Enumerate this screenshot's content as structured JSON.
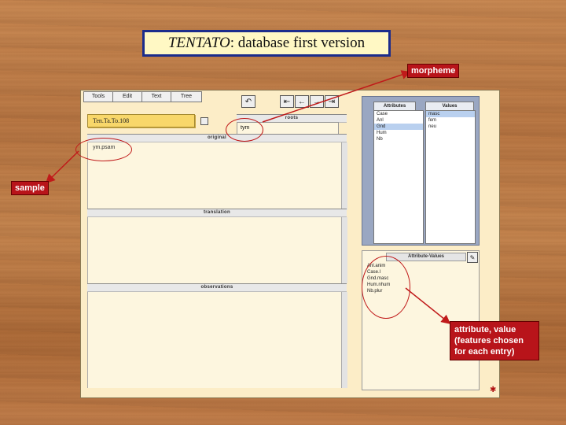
{
  "slide": {
    "title_italic": "TENTATO",
    "title_rest": ": database first version"
  },
  "callouts": {
    "morpheme": "morpheme",
    "sample": "sample",
    "attr_note_lines": [
      "attribute, value",
      "(features chosen",
      "for each entry)"
    ]
  },
  "app": {
    "menu": [
      "Tools",
      "Edit",
      "Text",
      "Tree"
    ],
    "nav_icons": [
      "back-to-start-icon",
      "back-icon",
      "forward-icon",
      "forward-to-end-icon"
    ],
    "entry_name": "Ten.Ta.To.108",
    "sections": {
      "original": "original",
      "translation": "translation",
      "observations": "observations",
      "roots": "roots"
    },
    "original_text": "ym.psam",
    "morpheme_value": "tym",
    "attributes": {
      "header": "Attributes",
      "items": [
        "Case",
        "Anl",
        "Gnd",
        "Hum",
        "Nb"
      ],
      "selected": "Gnd"
    },
    "values": {
      "header": "Values",
      "items": [
        "masc",
        "fem",
        "neu"
      ],
      "selected": "masc"
    },
    "attribute_values": {
      "header": "Attribute-Values",
      "items": [
        "Anl.anim",
        "Case.l",
        "Gnd.masc",
        "Hum.nhum",
        "Nb.plur"
      ]
    }
  },
  "colors": {
    "title_border": "#1b2c8c",
    "callout_red": "#b8141a",
    "app_bg": "#fcedc7",
    "entry_field": "#f8d76a"
  }
}
